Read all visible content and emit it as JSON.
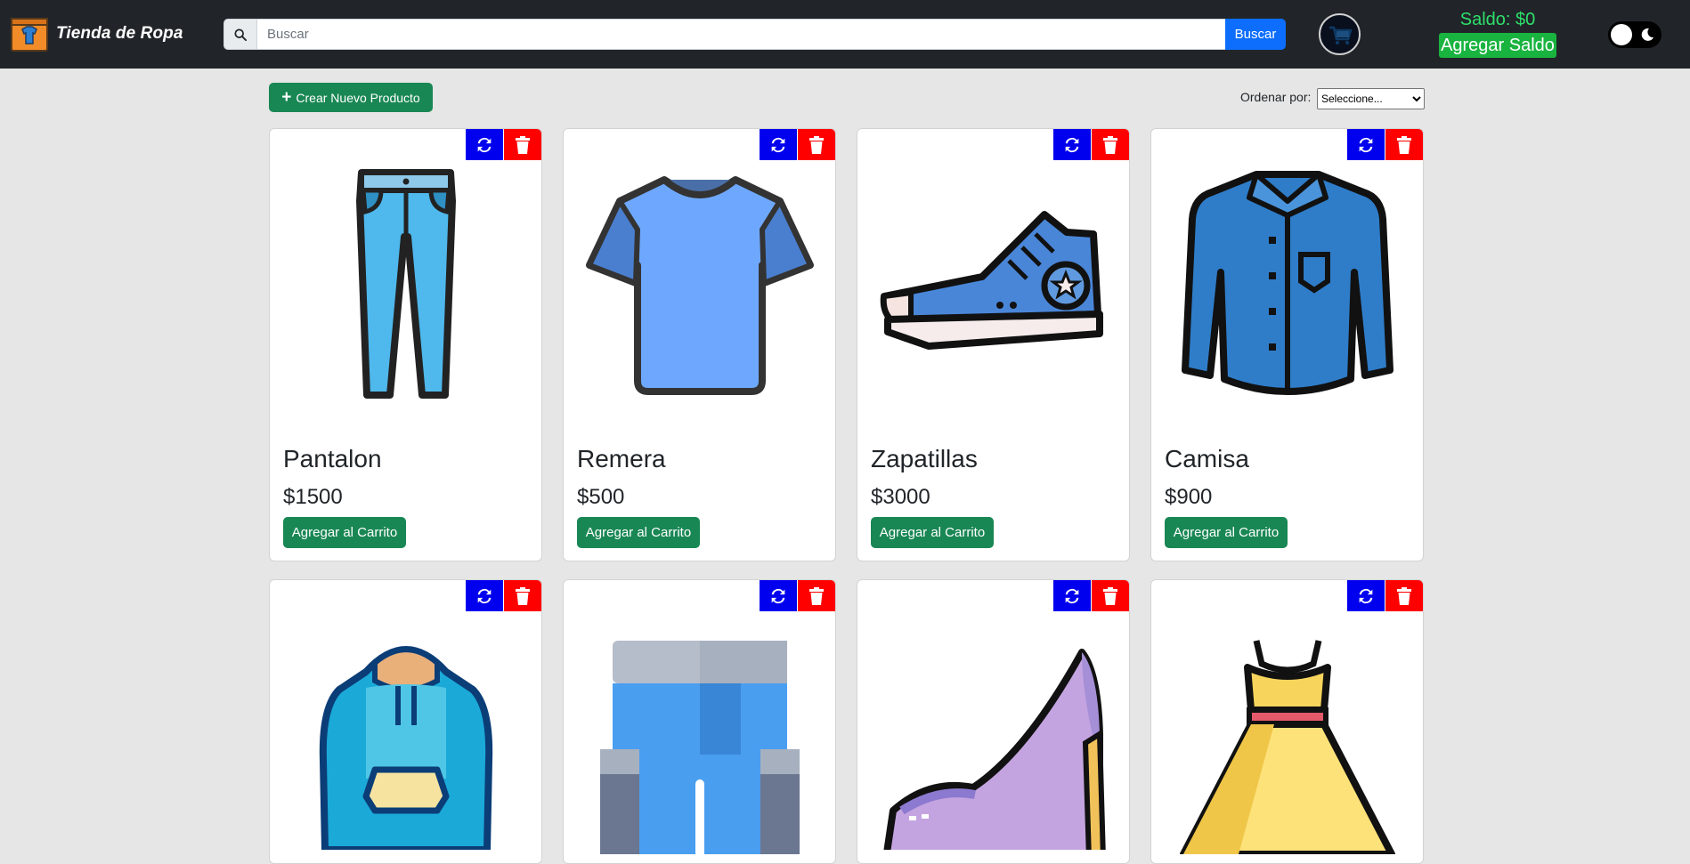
{
  "navbar": {
    "brand_name": "Tienda de Ropa",
    "search_placeholder": "Buscar",
    "search_button": "Buscar",
    "saldo_text": "Saldo: $0",
    "add_saldo_button": "Agregar Saldo",
    "logo_icon": "shirt-box-icon",
    "avatar_icon": "shopping-cart-icon",
    "theme_toggle_icon": "moon-icon"
  },
  "toolbar": {
    "create_button": "Crear Nuevo Producto",
    "sort_label": "Ordenar por:",
    "sort_selected": "Seleccione..."
  },
  "products": [
    {
      "name": "Pantalon",
      "price": "$1500",
      "button": "Agregar al Carrito",
      "icon": "pants-icon"
    },
    {
      "name": "Remera",
      "price": "$500",
      "button": "Agregar al Carrito",
      "icon": "tshirt-icon"
    },
    {
      "name": "Zapatillas",
      "price": "$3000",
      "button": "Agregar al Carrito",
      "icon": "sneaker-icon"
    },
    {
      "name": "Camisa",
      "price": "$900",
      "button": "Agregar al Carrito",
      "icon": "shirt-icon"
    },
    {
      "icon": "hoodie-icon"
    },
    {
      "icon": "shorts-icon"
    },
    {
      "icon": "high-heel-icon"
    },
    {
      "icon": "dress-icon"
    }
  ],
  "colors": {
    "navbar_bg": "#212529",
    "page_bg": "#e6e6e6",
    "primary_green": "#198754",
    "refresh_blue": "#0000ee",
    "delete_red": "#ff0000",
    "saldo_green": "#2ee06b",
    "search_blue": "#0d6efd"
  }
}
